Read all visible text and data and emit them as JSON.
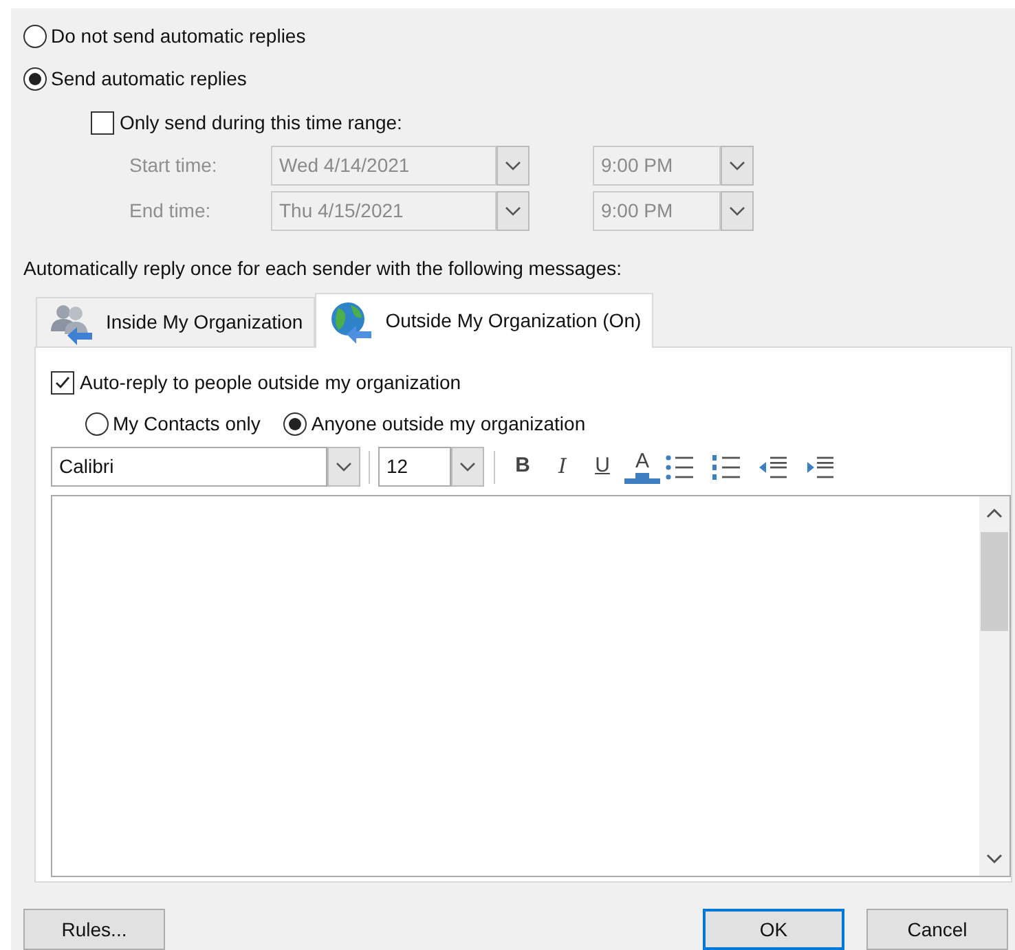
{
  "reply_mode": [
    {
      "label": "Do not send automatic replies",
      "selected": false
    },
    {
      "label": "Send automatic replies",
      "selected": true
    }
  ],
  "time_range": {
    "label": "Only send during this time range:",
    "checked": false,
    "disabled": true,
    "rows": [
      {
        "label": "Start time:",
        "date": "Wed 4/14/2021",
        "time": "9:00 PM"
      },
      {
        "label": "End time:",
        "date": "Thu 4/15/2021",
        "time": "9:00 PM"
      }
    ]
  },
  "messages_label": "Automatically reply once for each sender with the following messages:",
  "tabs": [
    {
      "label": "Inside My Organization",
      "kind": "people",
      "selected": false
    },
    {
      "label": "Outside My Organization (On)",
      "kind": "globe",
      "selected": true
    }
  ],
  "auto_reply": {
    "label": "Auto-reply to people outside my organization",
    "checked": true
  },
  "audience": [
    {
      "label": "My Contacts only",
      "selected": false
    },
    {
      "label": "Anyone outside my organization",
      "selected": true
    }
  ],
  "toolbar": {
    "font": "Calibri",
    "size": "12",
    "format_buttons": [
      {
        "kind": "bold",
        "label": "B"
      },
      {
        "kind": "italic",
        "label": "I"
      },
      {
        "kind": "underline",
        "label": "U"
      },
      {
        "kind": "color",
        "label": "A"
      }
    ]
  },
  "buttons": [
    {
      "label": "Rules...",
      "default": false
    },
    {
      "label": "OK",
      "default": true
    },
    {
      "label": "Cancel",
      "default": false
    }
  ]
}
